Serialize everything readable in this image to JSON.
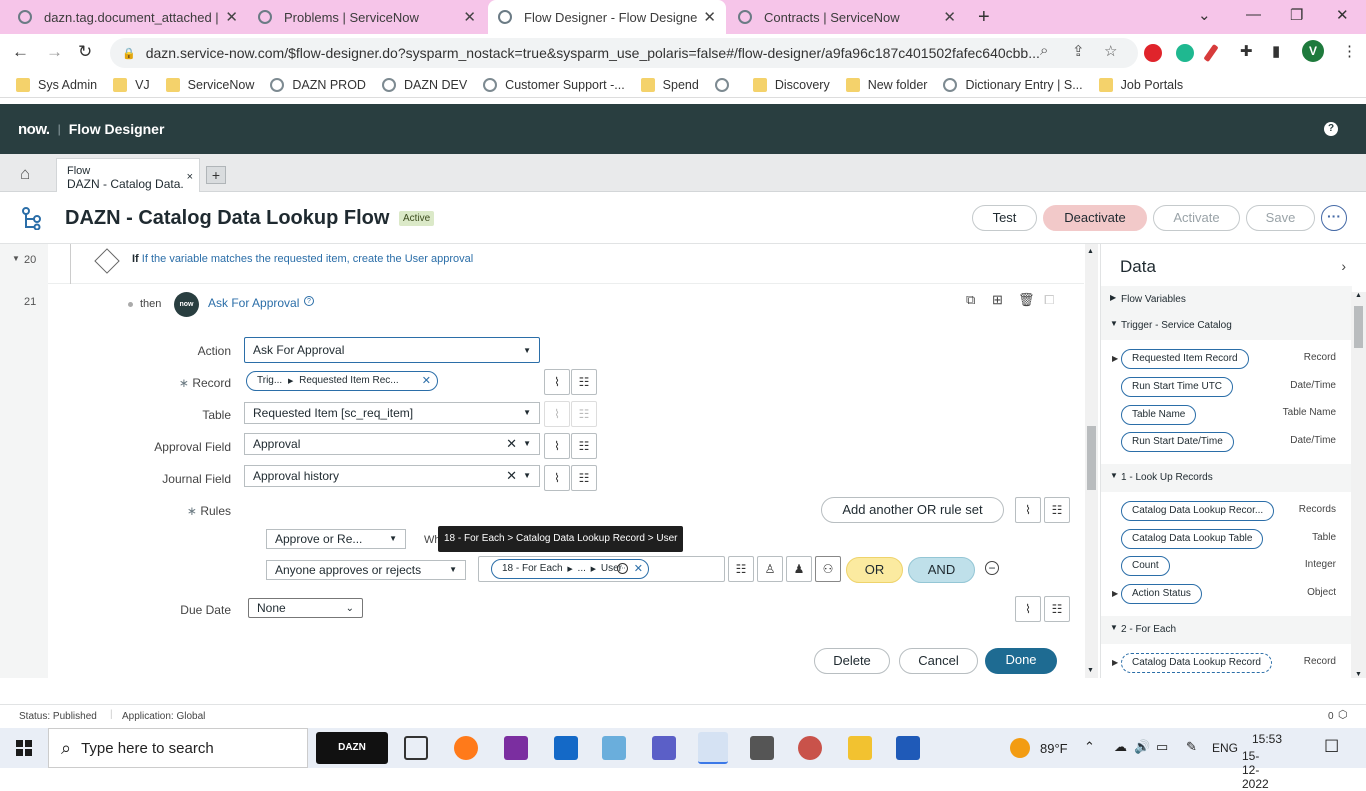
{
  "browser": {
    "tabs": [
      {
        "title": "dazn.tag.document_attached | Sy"
      },
      {
        "title": "Problems | ServiceNow"
      },
      {
        "title": "Flow Designer - Flow Designer : D"
      },
      {
        "title": "Contracts | ServiceNow"
      }
    ],
    "active_tab": 2,
    "url": "dazn.service-now.com/$flow-designer.do?sysparm_nostack=true&sysparm_use_polaris=false#/flow-designer/a9fa96c187c401502fafec640cbb...",
    "profile_initial": "V",
    "bookmarks": [
      "Sys Admin",
      "VJ",
      "ServiceNow",
      "DAZN PROD",
      "DAZN DEV",
      "Customer Support -...",
      "Spend",
      "",
      "Discovery",
      "New folder",
      "Dictionary Entry | S...",
      "Job Portals"
    ]
  },
  "app": {
    "logo": "now.",
    "title": "Flow Designer",
    "help": "?"
  },
  "designer_tab": {
    "type_label": "Flow",
    "name": "DAZN - Catalog Data...",
    "close": "×",
    "add": "+"
  },
  "flow": {
    "name": "DAZN - Catalog Data Lookup Flow",
    "status": "Active",
    "buttons": {
      "test": "Test",
      "deactivate": "Deactivate",
      "activate": "Activate",
      "save": "Save",
      "more": "···"
    }
  },
  "steps": {
    "row20": {
      "number": "20",
      "condition_prefix": "If",
      "condition": "If the variable matches the requested item, create the User approval"
    },
    "row21": {
      "number": "21",
      "then": "then",
      "badge": "now",
      "action_name": "Ask For Approval"
    }
  },
  "form": {
    "action": {
      "label": "Action",
      "value": "Ask For Approval"
    },
    "record": {
      "label": "Record",
      "required": "∗",
      "pill_part1": "Trig...",
      "pill_part2": "Requested Item Rec..."
    },
    "table": {
      "label": "Table",
      "value": "Requested Item [sc_req_item]"
    },
    "approval_field": {
      "label": "Approval Field",
      "value": "Approval"
    },
    "journal_field": {
      "label": "Journal Field",
      "value": "Approval history"
    },
    "rules": {
      "label": "Rules",
      "required": "∗",
      "add_rule_set": "Add another OR rule set",
      "condition_select": "Approve or Re...",
      "when_prefix": "Wh",
      "approver_select": "Anyone approves or rejects",
      "pill_part1": "18 - For Each",
      "pill_part2": "...",
      "pill_part3": "User",
      "or_label": "OR",
      "and_label": "AND"
    },
    "due_date": {
      "label": "Due Date",
      "value": "None"
    },
    "tooltip": "18 - For Each > Catalog Data Lookup Record > User",
    "footer": {
      "delete": "Delete",
      "cancel": "Cancel",
      "done": "Done"
    }
  },
  "data_panel": {
    "title": "Data",
    "sections": [
      {
        "label": "Flow Variables",
        "collapsed": true
      },
      {
        "label": "Trigger - Service Catalog",
        "items": [
          {
            "name": "Requested Item Record",
            "type": "Record",
            "expandable": true
          },
          {
            "name": "Run Start Time UTC",
            "type": "Date/Time"
          },
          {
            "name": "Table Name",
            "type": "Table Name"
          },
          {
            "name": "Run Start Date/Time",
            "type": "Date/Time"
          }
        ]
      },
      {
        "label": "1 - Look Up Records",
        "items": [
          {
            "name": "Catalog Data Lookup Recor...",
            "type": "Records"
          },
          {
            "name": "Catalog Data Lookup Table",
            "type": "Table"
          },
          {
            "name": "Count",
            "type": "Integer"
          },
          {
            "name": "Action Status",
            "type": "Object",
            "expandable": true
          }
        ]
      },
      {
        "label": "2 - For Each",
        "items": [
          {
            "name": "Catalog Data Lookup Record",
            "type": "Record",
            "expandable": true
          }
        ]
      }
    ]
  },
  "status_bar": {
    "status": "Status: Published",
    "application": "Application: Global",
    "count": "0"
  },
  "taskbar": {
    "search_placeholder": "Type here to search",
    "weather": "89°F",
    "language": "ENG",
    "time": "15:53",
    "date": "15-12-2022"
  },
  "colors": {
    "tab_strip": "#f6c5e9",
    "sn_header": "#293e40",
    "link_blue": "#2b6ea8",
    "deactivate_bg": "#f2c9c9",
    "or_bg": "#fbeaa0",
    "and_bg": "#bfe0ea",
    "done_bg": "#1e6b92"
  }
}
